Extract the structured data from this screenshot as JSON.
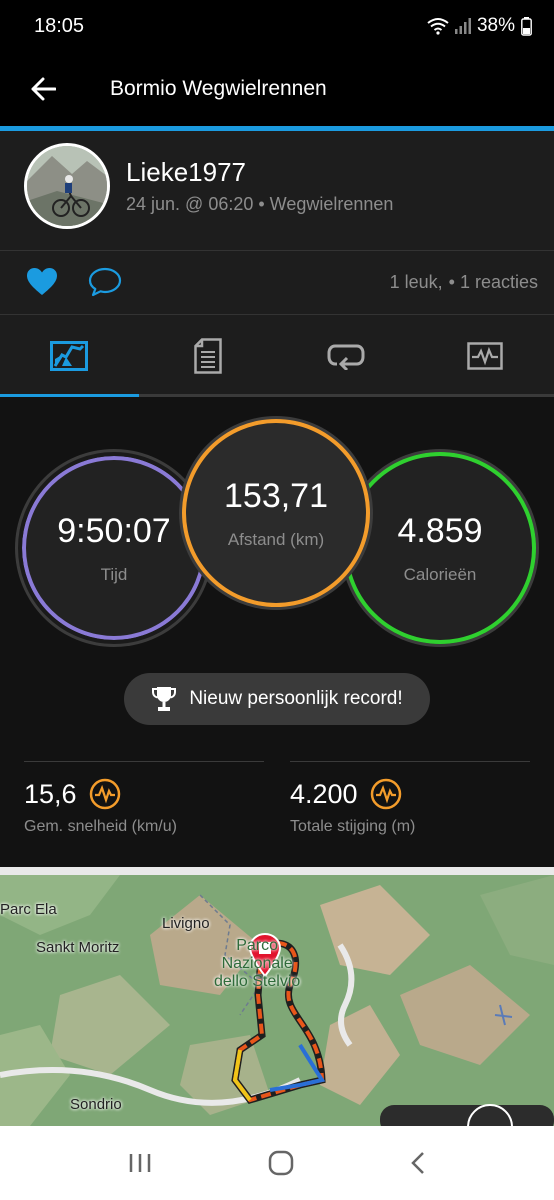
{
  "status_bar": {
    "time": "18:05",
    "battery": "38%"
  },
  "app_bar": {
    "title": "Bormio Wegwielrennen"
  },
  "colors": {
    "accent": "#1b9be0",
    "time_ring": "#8a7ad6",
    "distance_ring": "#f39c2b",
    "calories_ring": "#2fd02f",
    "metric_icon": "#f39c2b"
  },
  "profile": {
    "name": "Lieke1977",
    "meta": "24 jun. @ 06:20 • Wegwielrennen"
  },
  "social": {
    "likes": "1 leuk,",
    "comments": "• 1 reacties"
  },
  "tabs": [
    {
      "icon": "map-tab-icon",
      "active": true
    },
    {
      "icon": "details-tab-icon",
      "active": false
    },
    {
      "icon": "laps-tab-icon",
      "active": false
    },
    {
      "icon": "charts-tab-icon",
      "active": false
    }
  ],
  "stats": {
    "time": {
      "value": "9:50:07",
      "label": "Tijd"
    },
    "distance": {
      "value": "153,71",
      "label": "Afstand (km)"
    },
    "calories": {
      "value": "4.859",
      "label": "Calorieën"
    }
  },
  "record": {
    "label": "Nieuw persoonlijk record!"
  },
  "metrics": {
    "speed": {
      "value": "15,6",
      "label": "Gem. snelheid (km/u)"
    },
    "climb": {
      "value": "4.200",
      "label": "Totale stijging (m)"
    }
  },
  "map": {
    "labels": {
      "parc_ela": "Parc Ela",
      "livigno": "Livigno",
      "sankt_moritz": "Sankt Moritz",
      "sondrio": "Sondrio",
      "park_line1": "Parco",
      "park_line2": "Nazionale",
      "park_line3": "dello Stelvio"
    }
  }
}
